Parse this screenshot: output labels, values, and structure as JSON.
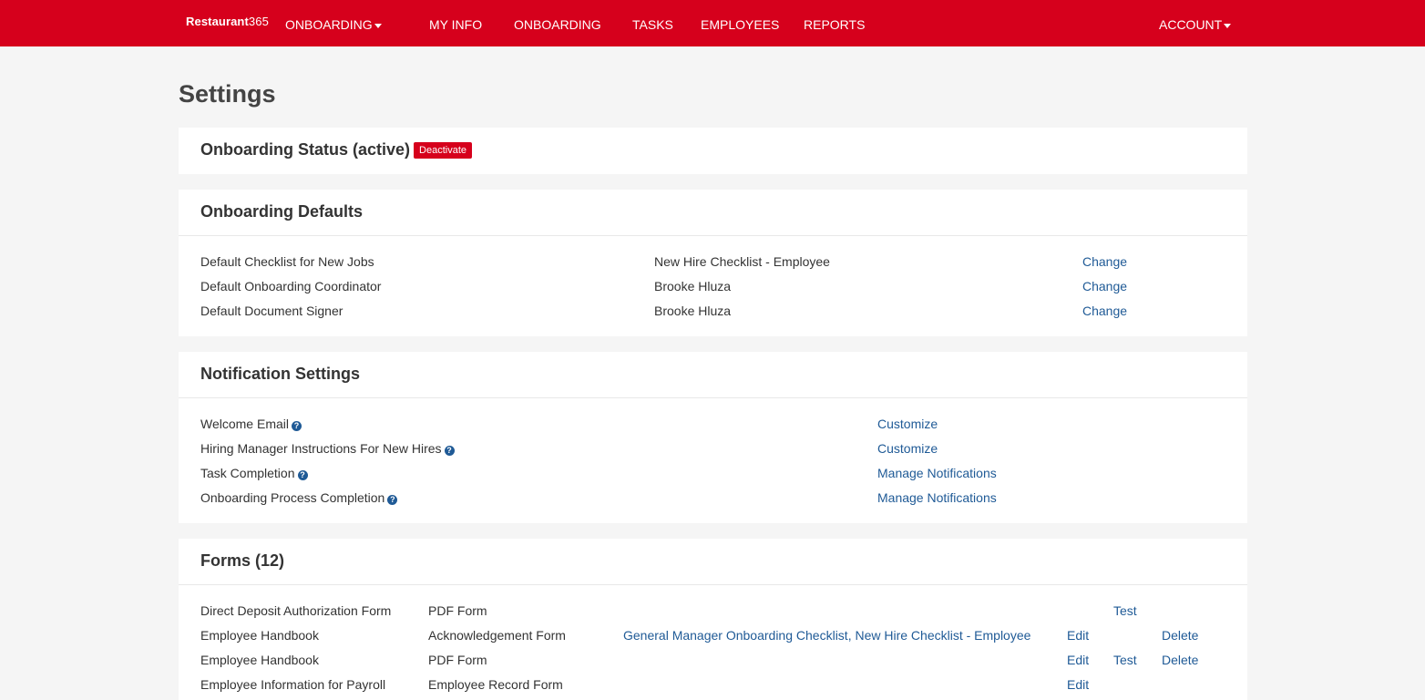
{
  "nav": {
    "brand": "Restaurant",
    "brand_num": "365",
    "dropdown": "ONBOARDING",
    "items": [
      "MY INFO",
      "ONBOARDING",
      "TASKS",
      "EMPLOYEES",
      "REPORTS"
    ],
    "account": "ACCOUNT"
  },
  "page_title": "Settings",
  "status": {
    "title": "Onboarding Status (active)",
    "button": "Deactivate"
  },
  "defaults": {
    "title": "Onboarding Defaults",
    "rows": [
      {
        "label": "Default Checklist for New Jobs",
        "value": "New Hire Checklist - Employee",
        "action": "Change"
      },
      {
        "label": "Default Onboarding Coordinator",
        "value": "Brooke Hluza",
        "action": "Change"
      },
      {
        "label": "Default Document Signer",
        "value": "Brooke Hluza",
        "action": "Change"
      }
    ]
  },
  "notifications": {
    "title": "Notification Settings",
    "help_glyph": "?",
    "rows": [
      {
        "label": "Welcome Email",
        "action": "Customize"
      },
      {
        "label": "Hiring Manager Instructions For New Hires",
        "action": "Customize"
      },
      {
        "label": "Task Completion",
        "action": "Manage Notifications"
      },
      {
        "label": "Onboarding Process Completion",
        "action": "Manage Notifications"
      }
    ]
  },
  "forms": {
    "title": "Forms (12)",
    "rows": [
      {
        "name": "Direct Deposit Authorization Form",
        "type": "PDF Form",
        "checklists": "",
        "edit": "",
        "test": "Test",
        "delete": ""
      },
      {
        "name": "Employee Handbook",
        "type": "Acknowledgement Form",
        "checklists": "General Manager Onboarding Checklist, New Hire Checklist - Employee",
        "edit": "Edit",
        "test": "",
        "delete": "Delete"
      },
      {
        "name": "Employee Handbook",
        "type": "PDF Form",
        "checklists": "",
        "edit": "Edit",
        "test": "Test",
        "delete": "Delete"
      },
      {
        "name": "Employee Information for Payroll",
        "type": "Employee Record Form",
        "checklists": "",
        "edit": "Edit",
        "test": "",
        "delete": ""
      }
    ]
  }
}
